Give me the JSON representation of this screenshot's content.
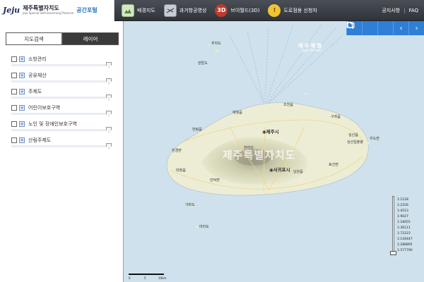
{
  "header": {
    "logo_mark": "Jeju",
    "logo_title": "제주특별자치도",
    "logo_subtitle": "Jeju Special Self-Governing Province",
    "portal_label": "공간포털",
    "nav": [
      {
        "label": "배경지도",
        "icon": "map-background-icon"
      },
      {
        "label": "과거항공영상",
        "icon": "aerial-photo-icon"
      },
      {
        "label": "브이월드(3D)",
        "icon": "3d-icon"
      },
      {
        "label": "도로점용 신청자",
        "icon": "road-warning-icon"
      }
    ],
    "notice_label": "공지사항",
    "faq_label": "FAQ"
  },
  "sidebar": {
    "tabs": [
      {
        "label": "지도검색",
        "active": false
      },
      {
        "label": "레이어",
        "active": true
      }
    ],
    "layers": [
      {
        "label": "소방관리",
        "checked": false,
        "opacity": 1.0
      },
      {
        "label": "공유재산",
        "checked": false,
        "opacity": 1.0
      },
      {
        "label": "주제도",
        "checked": false,
        "opacity": 1.0
      },
      {
        "label": "어린이보호구역",
        "checked": false,
        "opacity": 1.0
      },
      {
        "label": "노인 및 장애인보호구역",
        "checked": false,
        "opacity": 1.0
      },
      {
        "label": "산림주제도",
        "checked": false,
        "opacity": 1.0
      }
    ]
  },
  "map": {
    "labels": {
      "sea_ko": "제 주 해 협",
      "sea_en": "Jeju Strait",
      "province": "제주특별자치도",
      "jeju_city": "◉제주시",
      "seogwipo_city": "◉서귀포시",
      "chuja": "추자도",
      "gwantal": "관탈도",
      "aewol": "애월읍",
      "jocheon": "조천읍",
      "gujwa": "구좌읍",
      "hallim": "한림읍",
      "hangyeong": "한경면",
      "daejeong": "대정읍",
      "andeok": "안덕면",
      "namwon": "남원읍",
      "pyoseon": "표선면",
      "seongsan": "성산읍",
      "udo": "우도면",
      "marado": "마라도",
      "gapa": "가파도",
      "seongsan_ilchulbong": "성산일출봉",
      "hallasan": "한라산"
    },
    "tools": [
      {
        "icon": "crop-icon"
      },
      {
        "icon": "refresh-icon"
      },
      {
        "icon": "folder-icon"
      },
      {
        "icon": "chevron-left-icon"
      },
      {
        "icon": "chevron-right-icon"
      }
    ],
    "scale": {
      "ticks": [
        "0",
        "5",
        "10km"
      ]
    },
    "zoom_levels": [
      "1:1128",
      "1:2256",
      "1:4513",
      "1:9027",
      "1:18055",
      "1:36111",
      "1:72223",
      "1:144447",
      "1:288895",
      "1:577790"
    ]
  }
}
